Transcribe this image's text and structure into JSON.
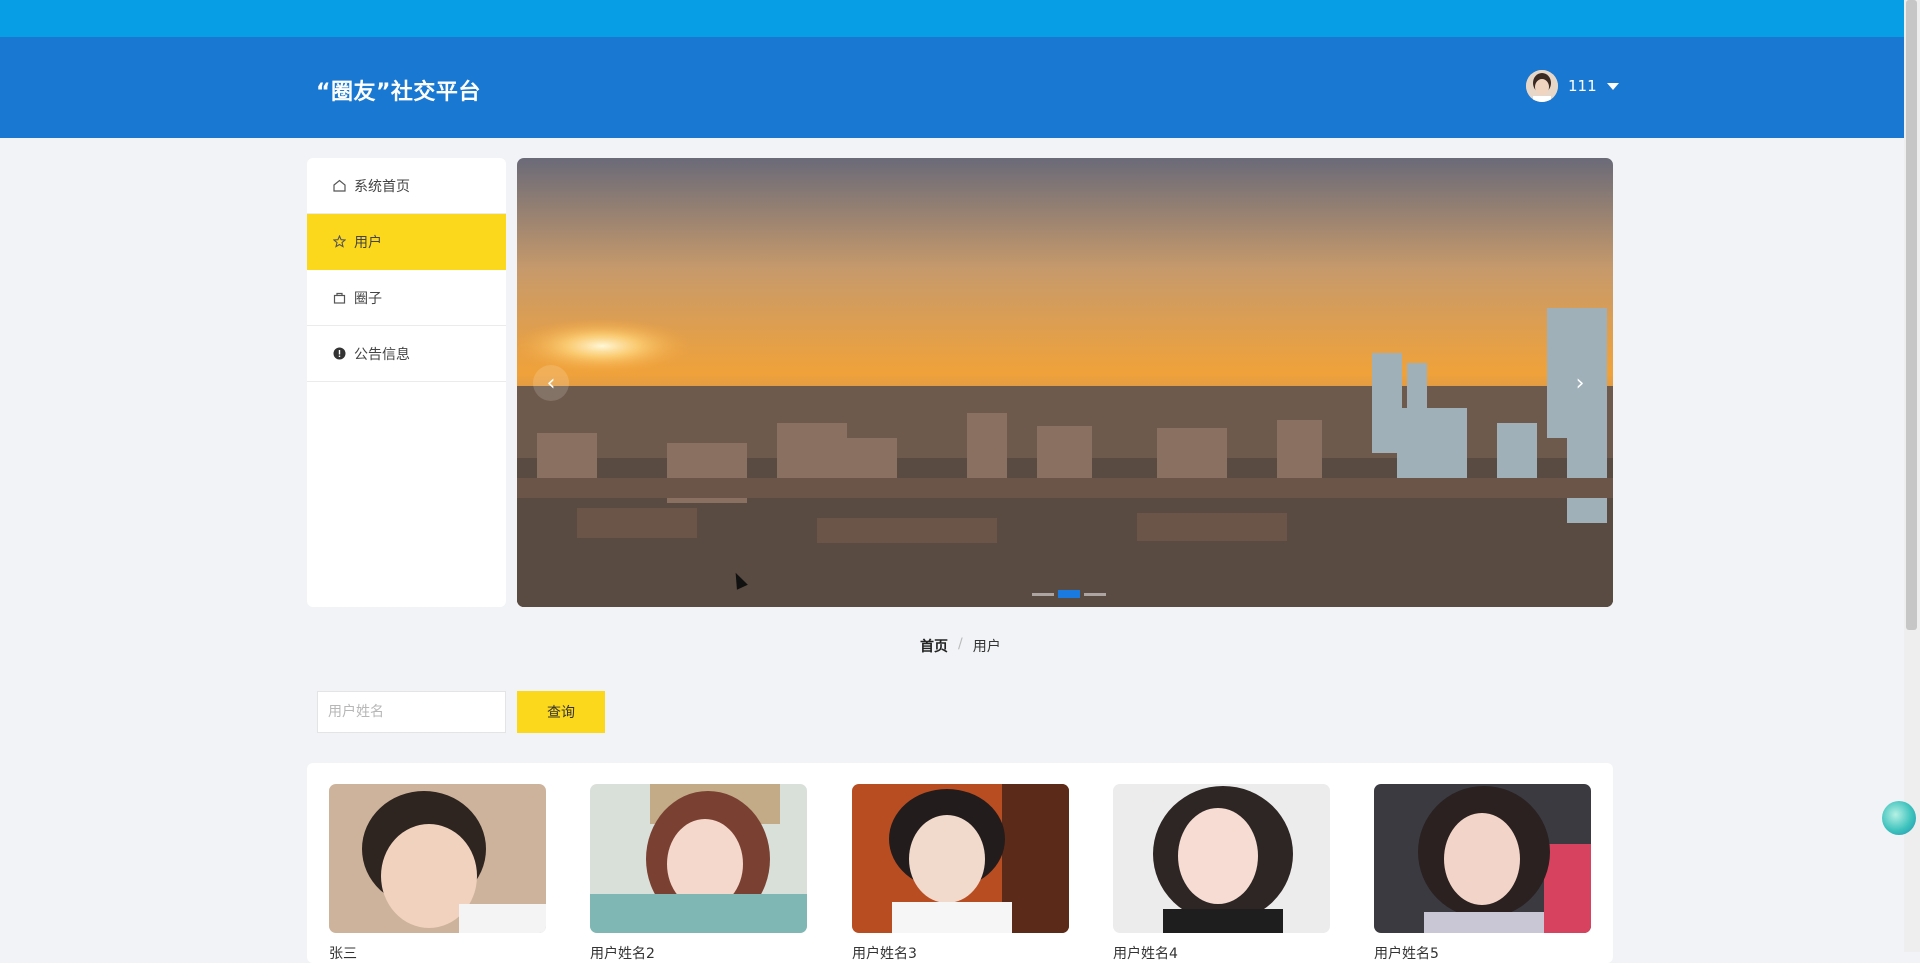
{
  "header": {
    "site_title": "“圈友”社交平台",
    "username": "111"
  },
  "sidebar": {
    "items": [
      {
        "label": "系统首页",
        "icon": "home-icon",
        "active": false
      },
      {
        "label": "用户",
        "icon": "star-icon",
        "active": true
      },
      {
        "label": "圈子",
        "icon": "bag-icon",
        "active": false
      },
      {
        "label": "公告信息",
        "icon": "info-icon",
        "active": false
      }
    ]
  },
  "carousel": {
    "slide_count": 3,
    "active_slide": 2
  },
  "breadcrumb": {
    "home": "首页",
    "separator": "/",
    "current": "用户"
  },
  "search": {
    "placeholder": "用户姓名",
    "value": "",
    "button_label": "查询"
  },
  "users": [
    {
      "name": "张三"
    },
    {
      "name": "用户姓名2"
    },
    {
      "name": "用户姓名3"
    },
    {
      "name": "用户姓名4"
    },
    {
      "name": "用户姓名5"
    }
  ],
  "colors": {
    "header": "#1978d2",
    "top_strip": "#079ee6",
    "accent": "#fcd81c",
    "page_bg": "#f1f3f6"
  }
}
